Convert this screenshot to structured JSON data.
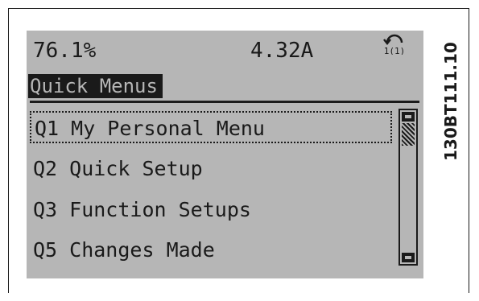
{
  "status": {
    "percent": "76.1%",
    "current": "4.32A",
    "setup_icon": "setup-cycle-icon",
    "setup_label": "1(1)"
  },
  "title": "Quick Menus",
  "menu": {
    "items": [
      {
        "label": "Q1 My Personal Menu",
        "selected": true
      },
      {
        "label": "Q2 Quick Setup",
        "selected": false
      },
      {
        "label": "Q3 Function Setups",
        "selected": false
      },
      {
        "label": "Q5 Changes Made",
        "selected": false
      }
    ]
  },
  "scrollbar": {
    "position": 0
  },
  "figure_code": "130BT111.10",
  "colors": {
    "lcd_background": "#b6b6b6",
    "lcd_foreground": "#1a1a1a"
  }
}
